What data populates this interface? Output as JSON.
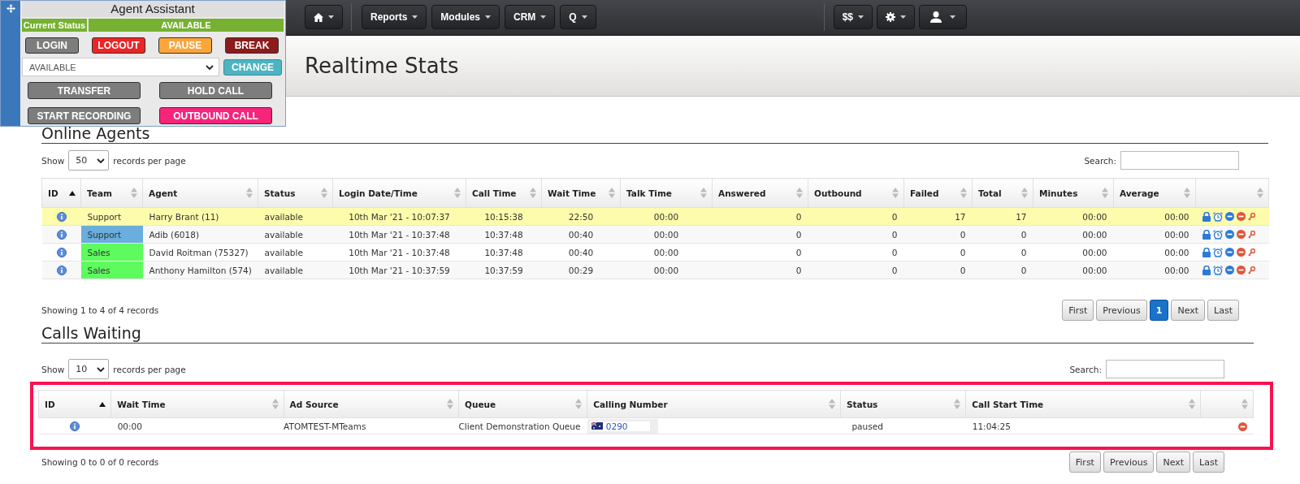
{
  "navbar": {
    "left_menus": [
      {
        "kind": "home"
      },
      {
        "kind": "text",
        "label": "Reports"
      },
      {
        "kind": "text",
        "label": "Modules"
      },
      {
        "kind": "text",
        "label": "CRM"
      },
      {
        "kind": "text",
        "label": "Q"
      }
    ],
    "right_menus": [
      {
        "kind": "text",
        "label": "$$"
      },
      {
        "kind": "settings"
      },
      {
        "kind": "user"
      }
    ]
  },
  "agent_assistant": {
    "title": "Agent Assistant",
    "status_label": "Current Status",
    "status_value": "AVAILABLE",
    "state_buttons": [
      {
        "label": "LOGIN",
        "color": "#7d7d7d"
      },
      {
        "label": "LOGOUT",
        "color": "#ec2526"
      },
      {
        "label": "PAUSE",
        "color": "#fba53b"
      },
      {
        "label": "BREAK",
        "color": "#8c1b1b"
      }
    ],
    "status_select": {
      "value": "AVAILABLE"
    },
    "change_button": "CHANGE",
    "call_buttons": [
      {
        "label": "TRANSFER",
        "color": "#7d7d7d"
      },
      {
        "label": "HOLD CALL",
        "color": "#7d7d7d"
      },
      {
        "label": "START RECORDING",
        "color": "#7d7d7d"
      },
      {
        "label": "OUTBOUND CALL",
        "color": "#f7247c"
      }
    ]
  },
  "page_title": "Realtime Stats",
  "online_agents": {
    "heading": "Online Agents",
    "show_label": "Show",
    "page_length": "50",
    "per_page_label": "records per page",
    "search_label": "Search:",
    "columns": [
      {
        "label": "ID",
        "sorted": true
      },
      {
        "label": "Team",
        "sorted": false
      },
      {
        "label": "Agent",
        "sorted": false
      },
      {
        "label": "Status",
        "sorted": false
      },
      {
        "label": "Login Date/Time",
        "sorted": false
      },
      {
        "label": "Call Time",
        "sorted": false
      },
      {
        "label": "Wait Time",
        "sorted": false
      },
      {
        "label": "Talk Time",
        "sorted": false
      },
      {
        "label": "Answered",
        "sorted": false
      },
      {
        "label": "Outbound",
        "sorted": false
      },
      {
        "label": "Failed",
        "sorted": false
      },
      {
        "label": "Total",
        "sorted": false
      },
      {
        "label": "Minutes",
        "sorted": false
      },
      {
        "label": "Average",
        "sorted": false
      },
      {
        "sorted": false
      }
    ],
    "rows": [
      {
        "highlighted": true,
        "cells": [
          "",
          "Support",
          "Harry Brant (11)",
          "available",
          "10th Mar '21 - 10:07:37",
          "10:15:38",
          "22:50",
          "00:00",
          "0",
          "0",
          "17",
          "17",
          "00:00",
          "00:00"
        ]
      },
      {
        "highlighted": false,
        "color": "#6aaedd",
        "cells": [
          "",
          "Support",
          "Adib (6018)",
          "available",
          "10th Mar '21 - 10:37:48",
          "10:37:48",
          "00:40",
          "00:00",
          "0",
          "0",
          "0",
          "0",
          "00:00",
          "00:00"
        ]
      },
      {
        "highlighted": false,
        "color": "#5efb5e",
        "cells": [
          "",
          "Sales",
          "David Roitman (75327)",
          "available",
          "10th Mar '21 - 10:37:48",
          "10:37:48",
          "00:40",
          "00:00",
          "0",
          "0",
          "0",
          "0",
          "00:00",
          "00:00"
        ]
      },
      {
        "highlighted": false,
        "color": "#5efb5e",
        "cells": [
          "",
          "Sales",
          "Anthony Hamilton (574)",
          "available",
          "10th Mar '21 - 10:37:59",
          "10:37:59",
          "00:29",
          "00:00",
          "0",
          "0",
          "0",
          "0",
          "00:00",
          "00:00"
        ]
      }
    ],
    "info": "Showing 1 to 4 of 4 records",
    "pagination": [
      {
        "label": "First",
        "selected": false
      },
      {
        "label": "Previous",
        "selected": false
      },
      {
        "label": "1",
        "selected": true
      },
      {
        "label": "Next",
        "selected": false
      },
      {
        "label": "Last",
        "selected": false
      }
    ]
  },
  "calls_waiting": {
    "heading": "Calls Waiting",
    "show_label": "Show",
    "page_length": "10",
    "per_page_label": "records per page",
    "search_label": "Search:",
    "highlighted": true,
    "columns": [
      {
        "label": "ID",
        "sorted": true
      },
      {
        "label": "Wait Time",
        "sorted": false
      },
      {
        "label": "Ad Source",
        "sorted": false
      },
      {
        "label": "Queue",
        "sorted": false
      },
      {
        "label": "Calling Number",
        "sorted": false
      },
      {
        "label": "Status",
        "sorted": false
      },
      {
        "label": "Call Start Time",
        "sorted": false
      },
      {
        "sorted": false
      }
    ],
    "rows": [
      {
        "wait_time": "00:00",
        "ad_source": "ATOMTEST-MTeams",
        "queue": "Client Demonstration Queue",
        "calling_number": "0290",
        "status": "paused",
        "call_start_time": "11:04:25"
      }
    ],
    "info": "Showing 0 to 0 of 0 records",
    "pagination": [
      {
        "label": "First",
        "selected": false
      },
      {
        "label": "Previous",
        "selected": false
      },
      {
        "label": "Next",
        "selected": false
      },
      {
        "label": "Last",
        "selected": false
      }
    ]
  }
}
